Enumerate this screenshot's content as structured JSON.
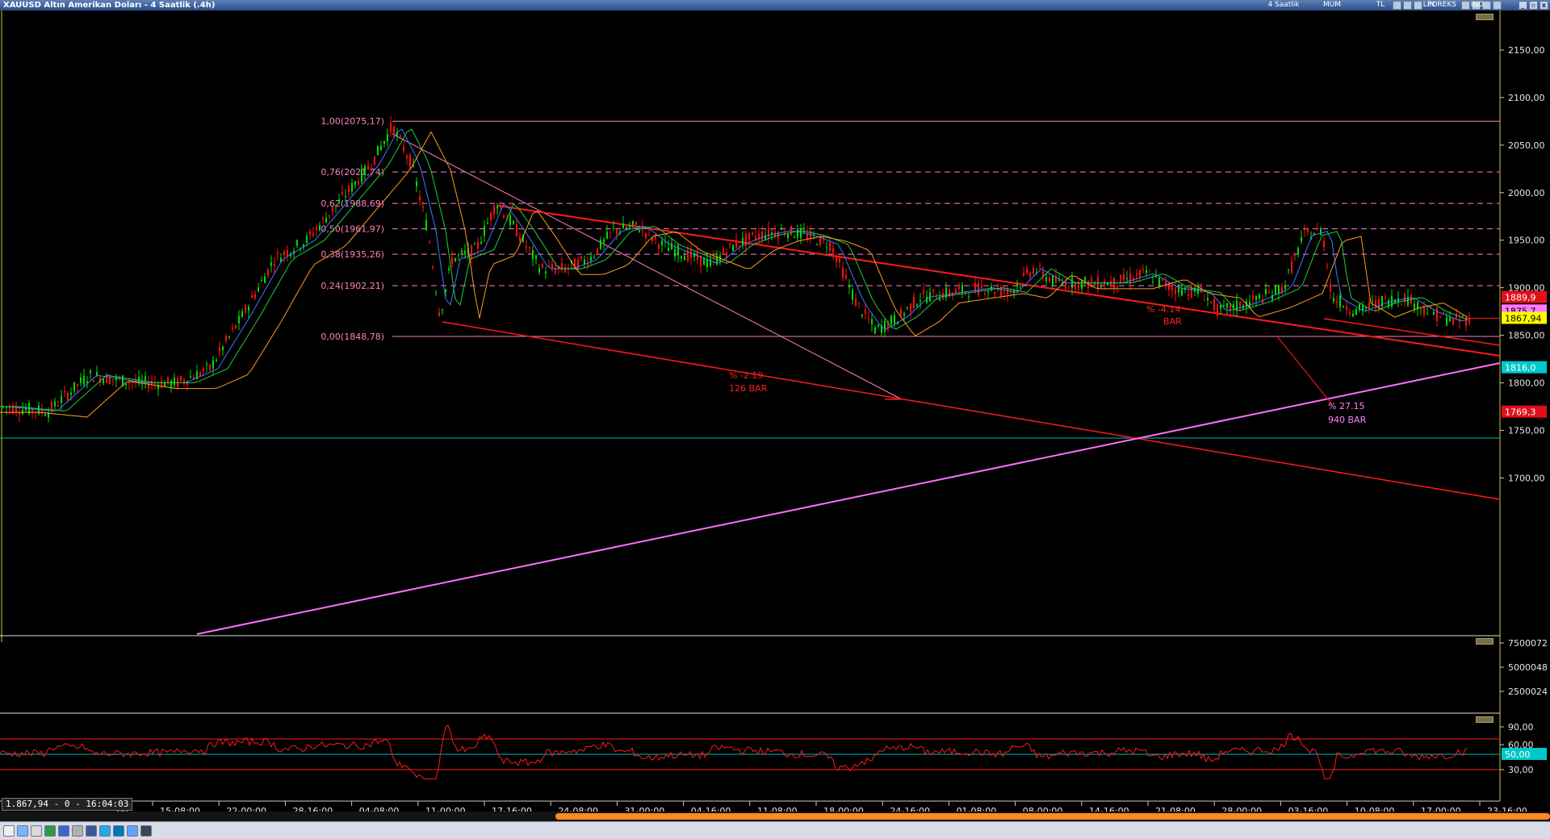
{
  "window": {
    "title": "XAUUSD Altın Amerikan Doları - 4 Saatlik (.4h)",
    "toolbar_labels": [
      "4 Saatlik",
      "MUM",
      "TL",
      "LIN",
      "IND"
    ],
    "forex_tag": "FOREKS"
  },
  "readout": "1.867,94 - 0 - 16:04:03",
  "price_axis": {
    "ticks": [
      "2150,00",
      "2100,00",
      "2050,00",
      "2000,00",
      "1950,00",
      "1900,00",
      "1850,00",
      "1800,00",
      "1750,00",
      "1700,00"
    ],
    "tags": [
      {
        "label": "1889,9",
        "color": "#e0101a",
        "text_color": "#ffffff"
      },
      {
        "label": "1875,7",
        "color": "#ff7aff",
        "text_color": "#000000"
      },
      {
        "label": "1867,94",
        "color": "#ffff00",
        "text_color": "#000000"
      },
      {
        "label": "1816,0",
        "color": "#00c8c8",
        "text_color": "#ffffff"
      },
      {
        "label": "1769,3",
        "color": "#e0101a",
        "text_color": "#ffffff"
      }
    ]
  },
  "volume_axis": {
    "ticks": [
      "7500072",
      "5000048",
      "2500024"
    ]
  },
  "rsi_axis": {
    "ticks": [
      "90,00",
      "60,00",
      "30,00"
    ],
    "level_tag": "50,00"
  },
  "time_axis": {
    "labels": [
      ":00",
      "15-08:00",
      "22-00:00",
      "28-16:00",
      "04-08:00",
      "11-00:00",
      "17-16:00",
      "24-08:00",
      "31-00:00",
      "04-16:00",
      "11-08:00",
      "18-00:00",
      "24-16:00",
      "01-08:00",
      "08-00:00",
      "14-16:00",
      "21-08:00",
      "28-00:00",
      "03-16:00",
      "10-08:00",
      "17-00:00",
      "23-16:00"
    ]
  },
  "fib": {
    "levels": [
      {
        "label": "1,00(2075,17)",
        "price": 2075.17
      },
      {
        "label": "0,76(2021,74)",
        "price": 2021.74
      },
      {
        "label": "0,62(1988,69)",
        "price": 1988.69
      },
      {
        "label": "0,50(1961,97)",
        "price": 1961.97
      },
      {
        "label": "0,38(1935,26)",
        "price": 1935.26
      },
      {
        "label": "0,24(1902,21)",
        "price": 1902.21
      },
      {
        "label": "0,00(1848,78)",
        "price": 1848.78
      }
    ]
  },
  "annotations": [
    {
      "text": "% -2.19",
      "color": "#ff2020"
    },
    {
      "text": "126 BAR",
      "color": "#ff2020"
    },
    {
      "text": "% -4.14",
      "color": "#ff2020"
    },
    {
      "text": "BAR",
      "color": "#ff2020"
    },
    {
      "text": "% 27.15",
      "color": "#ff80ff"
    },
    {
      "text": "940 BAR",
      "color": "#ff80ff"
    }
  ],
  "colors": {
    "background": "#000000",
    "up_candle": "#00dd00",
    "down_candle": "#ff1010",
    "fib": "#ff80c0",
    "trend_red": "#ff1a1a",
    "trend_pink": "#ff70ff",
    "support_cyan": "#00b8b8",
    "rsi": "#ff1a1a",
    "ma_blue": "#3a7aff",
    "ma_green": "#20cc40",
    "ma_orange": "#ff9a20"
  },
  "bottom_icons": [
    "doc-icon",
    "table-icon",
    "print-icon",
    "excel-icon",
    "word-icon",
    "settings-icon",
    "facebook-icon",
    "twitter-icon",
    "linkedin-icon",
    "share-icon",
    "tumblr-icon"
  ]
}
